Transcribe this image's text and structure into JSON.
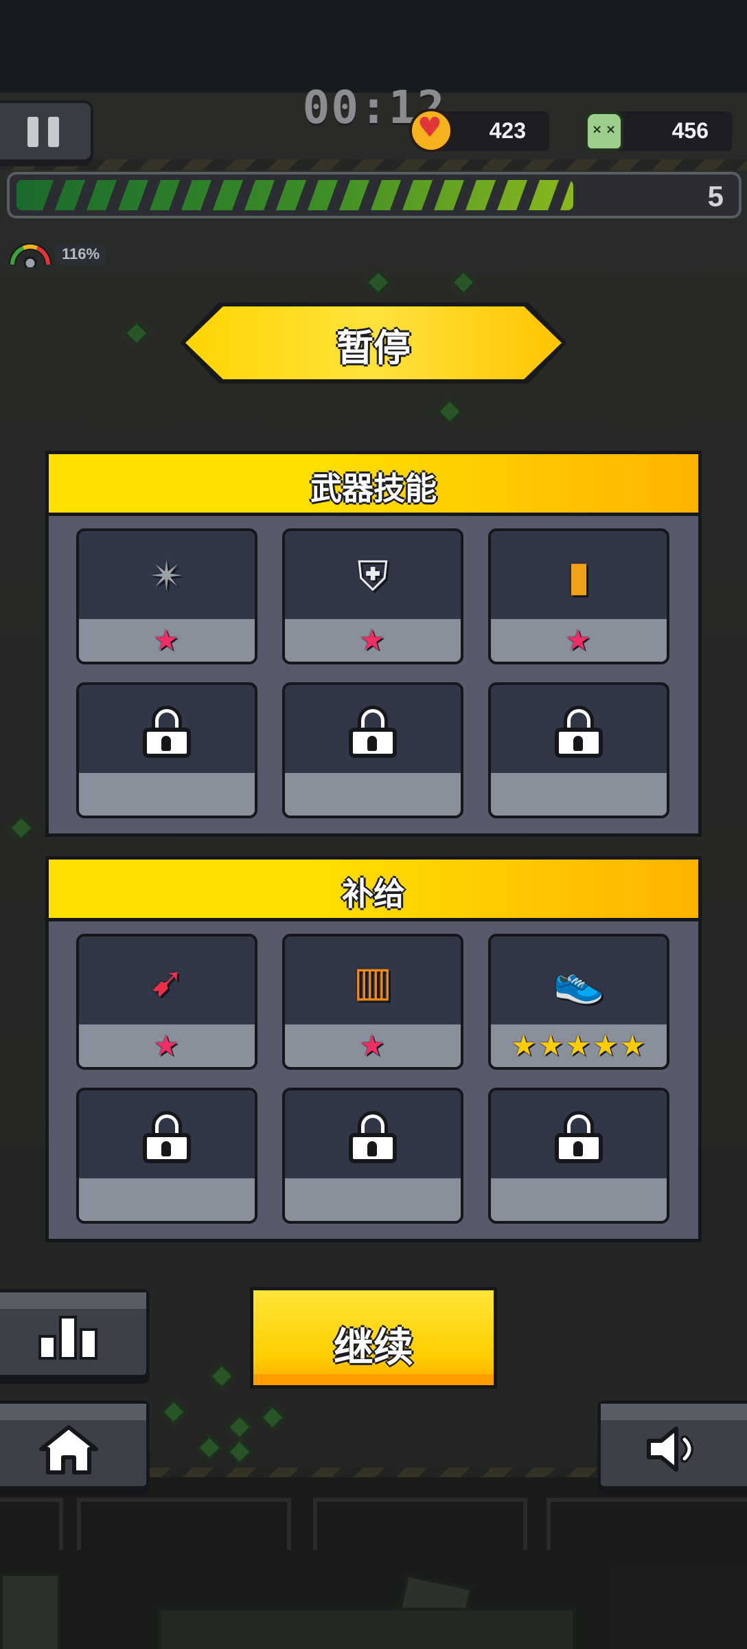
{
  "hud": {
    "timer": "00:12",
    "hearts": "423",
    "kills": "456",
    "level": "5",
    "speed": "116%",
    "xp_progress": 0.88,
    "icons": {
      "pause": "pause-icon",
      "heart": "heart-coin-icon",
      "kills": "zombie-kill-icon",
      "speed": "speed-gauge-icon"
    }
  },
  "pause_title": "暂停",
  "weapon_panel": {
    "title": "武器技能",
    "slots": [
      {
        "icon": "shuriken-icon",
        "glyph": "✴",
        "stars": "★",
        "locked": false
      },
      {
        "icon": "drone-icon",
        "glyph": "⛨",
        "stars": "★",
        "locked": false
      },
      {
        "icon": "canister-icon",
        "glyph": "▮",
        "stars": "★",
        "locked": false
      },
      {
        "icon": "lock-icon",
        "locked": true
      },
      {
        "icon": "lock-icon",
        "locked": true
      },
      {
        "icon": "lock-icon",
        "locked": true
      }
    ]
  },
  "supply_panel": {
    "title": "补给",
    "slots": [
      {
        "icon": "flame-bullet-icon",
        "glyph": "➹",
        "stars": "★",
        "locked": false
      },
      {
        "icon": "battery-icon",
        "glyph": "▥",
        "stars": "★",
        "locked": false
      },
      {
        "icon": "sneaker-icon",
        "glyph": "👟",
        "stars": "★★★★★",
        "locked": false
      },
      {
        "icon": "lock-icon",
        "locked": true
      },
      {
        "icon": "lock-icon",
        "locked": true
      },
      {
        "icon": "lock-icon",
        "locked": true
      }
    ]
  },
  "buttons": {
    "continue": "继续",
    "stats_icon": "bar-chart-icon",
    "home_icon": "home-icon",
    "sound_icon": "speaker-icon"
  },
  "colors": {
    "accent_yellow": "#ffd400",
    "panel_bg": "#565a6a",
    "slot_dark": "#323748",
    "slot_light": "#8a8f9c",
    "star_pink": "#ef2e66",
    "star_gold": "#ffcc00",
    "xp_green": "#3d8e26"
  }
}
